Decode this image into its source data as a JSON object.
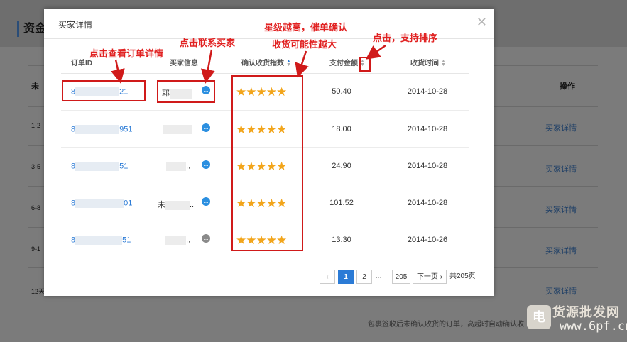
{
  "background": {
    "page_title": "资金",
    "col_left": "未",
    "col_action": "操作",
    "rows": [
      {
        "left": "1-2",
        "link": "买家详情"
      },
      {
        "left": "3-5",
        "link": "买家详情"
      },
      {
        "left": "6-8",
        "link": "买家详情"
      },
      {
        "left": "9-1",
        "link": "买家详情"
      },
      {
        "left": "12天",
        "link": "买家详情"
      }
    ],
    "footnote": "包裹签收后未确认收货的订单，高超时自动确认收"
  },
  "watermark": {
    "text": "货源批发网",
    "url": "www.6pf.cn",
    "logo": "电"
  },
  "modal": {
    "title": "买家详情",
    "close_icon": "close-icon",
    "columns": {
      "order_id": "订单ID",
      "buyer_info": "买家信息",
      "rating": "确认收货指数",
      "amount": "支付金额",
      "received_time": "收货时间"
    },
    "rows": [
      {
        "order_id_start": "8",
        "order_id_end": "21",
        "buyer": "耶",
        "buyer_tail": "",
        "stars": "★★★★★",
        "amount": "50.40",
        "date": "2014-10-28",
        "chat_online": true
      },
      {
        "order_id_start": "8",
        "order_id_end": "951",
        "buyer": "",
        "buyer_tail": "",
        "stars": "★★★★★",
        "amount": "18.00",
        "date": "2014-10-28",
        "chat_online": true
      },
      {
        "order_id_start": "8",
        "order_id_end": "51",
        "buyer": "",
        "buyer_tail": "..",
        "stars": "★★★★★",
        "amount": "24.90",
        "date": "2014-10-28",
        "chat_online": true
      },
      {
        "order_id_start": "8",
        "order_id_end": "01",
        "buyer": "未",
        "buyer_tail": "..",
        "stars": "★★★★★",
        "amount": "101.52",
        "date": "2014-10-28",
        "chat_online": true
      },
      {
        "order_id_start": "8",
        "order_id_end": "51",
        "buyer": "",
        "buyer_tail": "..",
        "stars": "★★★★★",
        "amount": "13.30",
        "date": "2014-10-26",
        "chat_online": false
      }
    ],
    "pagination": {
      "prev": "‹",
      "pages": [
        "1",
        "2"
      ],
      "current": "1",
      "dots": "...",
      "last_page": "205",
      "next": "下一页 ›",
      "total": "共205页"
    }
  },
  "annotations": {
    "order_detail": "点击查看订单详情",
    "contact_buyer": "点击联系买家",
    "rating_line1": "星级越高，催单确认",
    "rating_line2": "收货可能性越大",
    "sort": "点击，支持排序"
  },
  "colors": {
    "accent": "#2b7bd6",
    "annotation": "#e12222",
    "star": "#f2a51b"
  }
}
